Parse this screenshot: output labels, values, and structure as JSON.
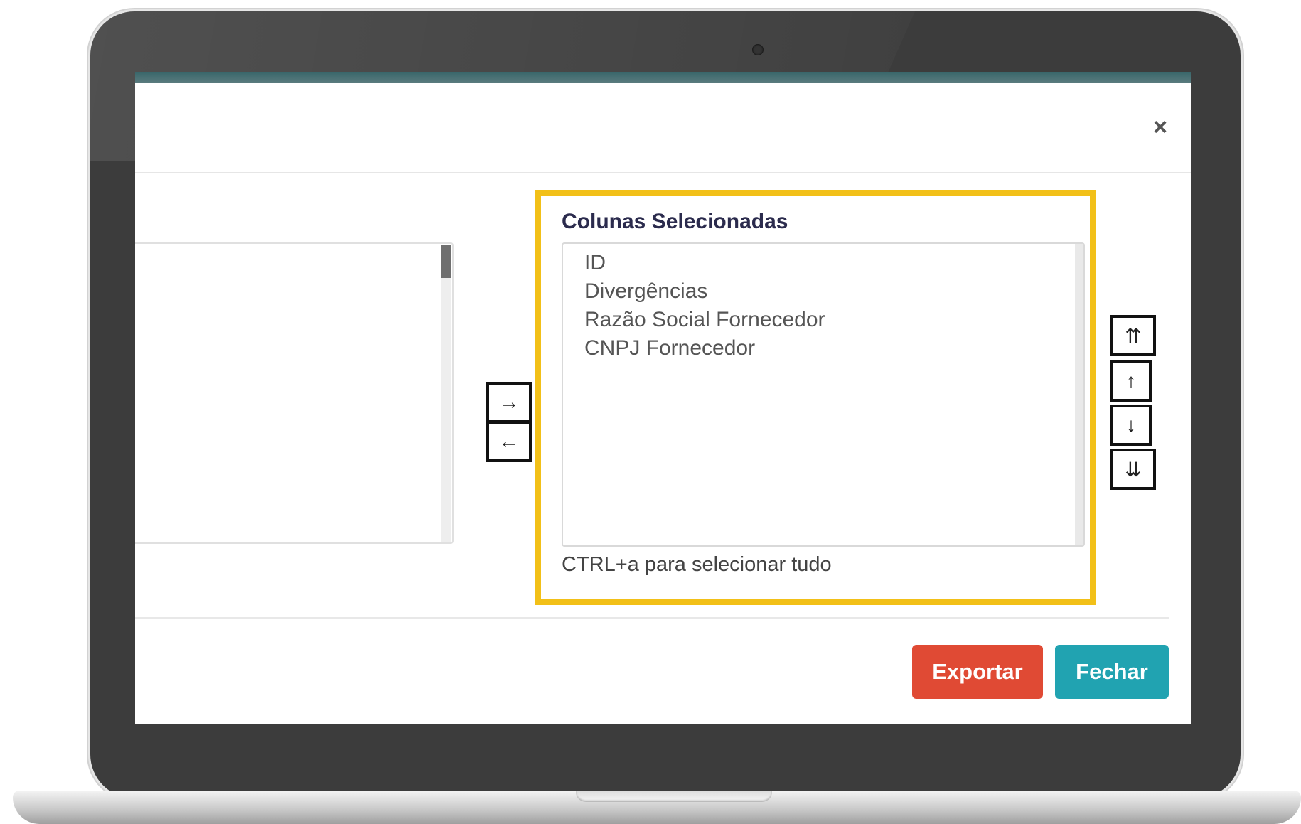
{
  "modal": {
    "close_glyph": "×",
    "selected_columns": {
      "title": "Colunas Selecionadas",
      "items": [
        "ID",
        "Divergências",
        "Razão Social Fornecedor",
        "CNPJ Fornecedor"
      ],
      "hint": "CTRL+a para selecionar tudo"
    },
    "transfer": {
      "add_glyph": "→",
      "remove_glyph": "←"
    },
    "order": {
      "top_glyph": "⇈",
      "up_glyph": "↑",
      "down_glyph": "↓",
      "bottom_glyph": "⇊"
    },
    "footer": {
      "export_label": "Exportar",
      "close_label": "Fechar"
    }
  },
  "colors": {
    "highlight": "#f2c018",
    "export_button": "#e04a34",
    "close_button": "#21a3b1",
    "bezel": "#3c3c3c"
  }
}
